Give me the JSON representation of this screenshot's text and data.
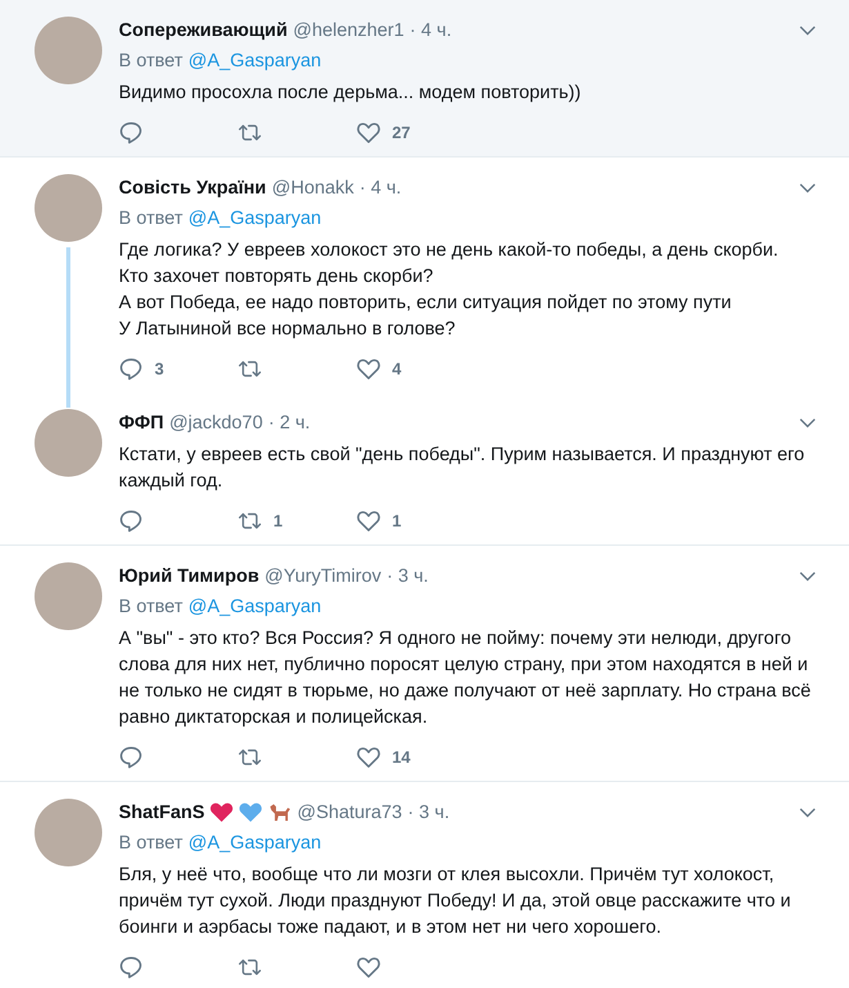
{
  "tweets": [
    {
      "name": "Сопереживающий",
      "handle": "@helenzher1",
      "time": "· 4 ч.",
      "reply_prefix": "В ответ",
      "reply_to": "@A_Gasparyan",
      "highlighted": true,
      "thread_line": false,
      "paragraphs": [
        "Видимо просохла после дерьма... модем повторить))"
      ],
      "likes": "27"
    },
    {
      "name": "Совість України",
      "handle": "@Honakk",
      "time": "· 4 ч.",
      "reply_prefix": "В ответ",
      "reply_to": "@A_Gasparyan",
      "highlighted": false,
      "thread_line": true,
      "paragraphs": [
        "Где логика? У евреев холокост это не день какой-то победы, а день скорби.",
        "Кто захочет повторять день скорби?",
        "А вот Победа, ее надо повторить, если ситуация пойдет по этому пути",
        "У Латыниной все нормально в голове?"
      ],
      "replies": "3",
      "likes": "4"
    },
    {
      "name": "ФФП",
      "handle": "@jackdo70",
      "time": "· 2 ч.",
      "highlighted": false,
      "thread_line": false,
      "paragraphs": [
        "Кстати, у евреев есть свой \"день победы\". Пурим называется. И празднуют его каждый год."
      ],
      "retweets": "1",
      "likes": "1"
    },
    {
      "name": "Юрий Тимиров",
      "handle": "@YuryTimirov",
      "time": "· 3 ч.",
      "reply_prefix": "В ответ",
      "reply_to": "@A_Gasparyan",
      "highlighted": false,
      "thread_line": false,
      "paragraphs": [
        "А \"вы\" - это кто? Вся Россия? Я одного не пойму: почему эти нелюди, другого слова для них нет, публично поросят целую страну, при этом находятся в ней и не только не сидят в тюрьме, но даже получают от неё зарплату. Но страна всё равно диктаторская и полицейская."
      ],
      "likes": "14"
    },
    {
      "name": "ShatFanS",
      "name_icons": [
        {
          "kind": "heart",
          "color": "#e0245e"
        },
        {
          "kind": "heart",
          "color": "#5dadec"
        },
        {
          "kind": "dog",
          "color": "#c1694f"
        }
      ],
      "handle": "@Shatura73",
      "time": "· 3 ч.",
      "reply_prefix": "В ответ",
      "reply_to": "@A_Gasparyan",
      "highlighted": false,
      "thread_line": false,
      "paragraphs": [
        "Бля, у неё что, вообще что ли мозги от клея высохли. Причём тут холокост, причём тут сухой. Люди празднуют Победу! И да, этой овце расскажите что и боинги и аэрбасы тоже падают, и в этом нет ни чего хорошего."
      ]
    }
  ]
}
